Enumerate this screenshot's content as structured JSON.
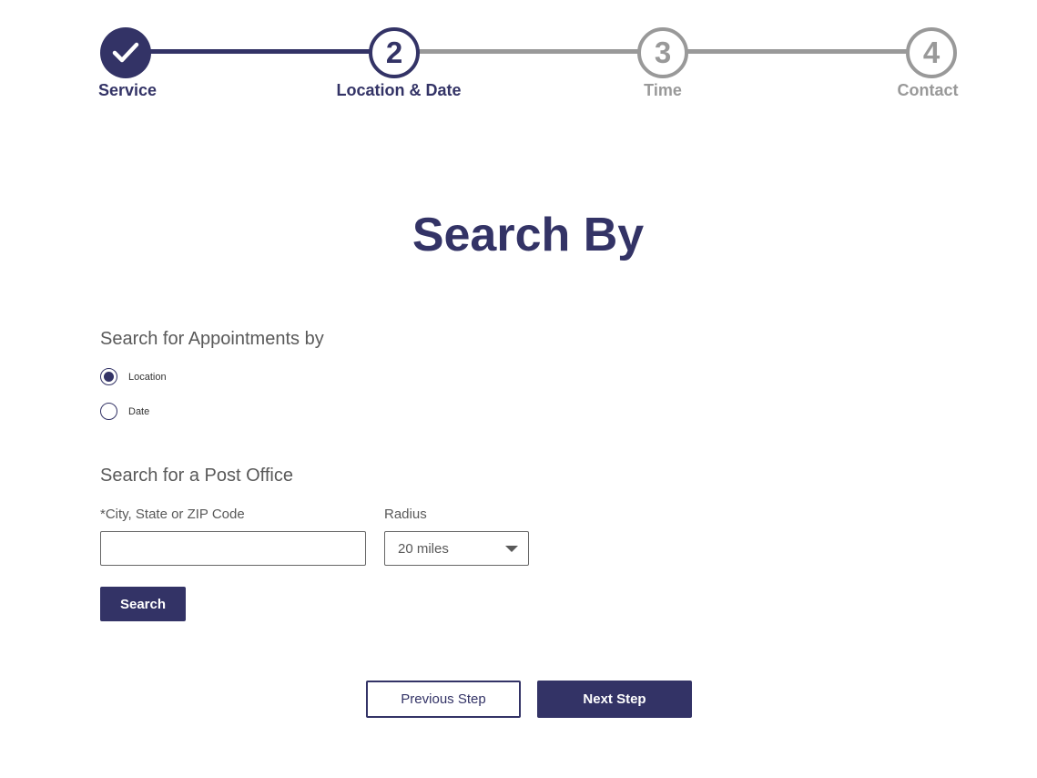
{
  "stepper": {
    "steps": [
      {
        "number": "",
        "label": "Service",
        "state": "complete",
        "icon": "check-icon"
      },
      {
        "number": "2",
        "label": "Location & Date",
        "state": "current"
      },
      {
        "number": "3",
        "label": "Time",
        "state": "upcoming"
      },
      {
        "number": "4",
        "label": "Contact",
        "state": "upcoming"
      }
    ]
  },
  "page": {
    "title": "Search By"
  },
  "search_type": {
    "heading": "Search for Appointments by",
    "options": [
      {
        "label": "Location",
        "checked": true
      },
      {
        "label": "Date",
        "checked": false
      }
    ]
  },
  "post_office": {
    "heading": "Search for a Post Office",
    "location_label": "*City, State or ZIP Code",
    "location_value": "",
    "radius_label": "Radius",
    "radius_value": "20 miles",
    "search_button": "Search"
  },
  "navigation": {
    "previous_label": "Previous Step",
    "next_label": "Next Step"
  },
  "colors": {
    "primary": "#333366",
    "inactive": "#999999",
    "text_muted": "#595959",
    "background": "#ffffff"
  }
}
